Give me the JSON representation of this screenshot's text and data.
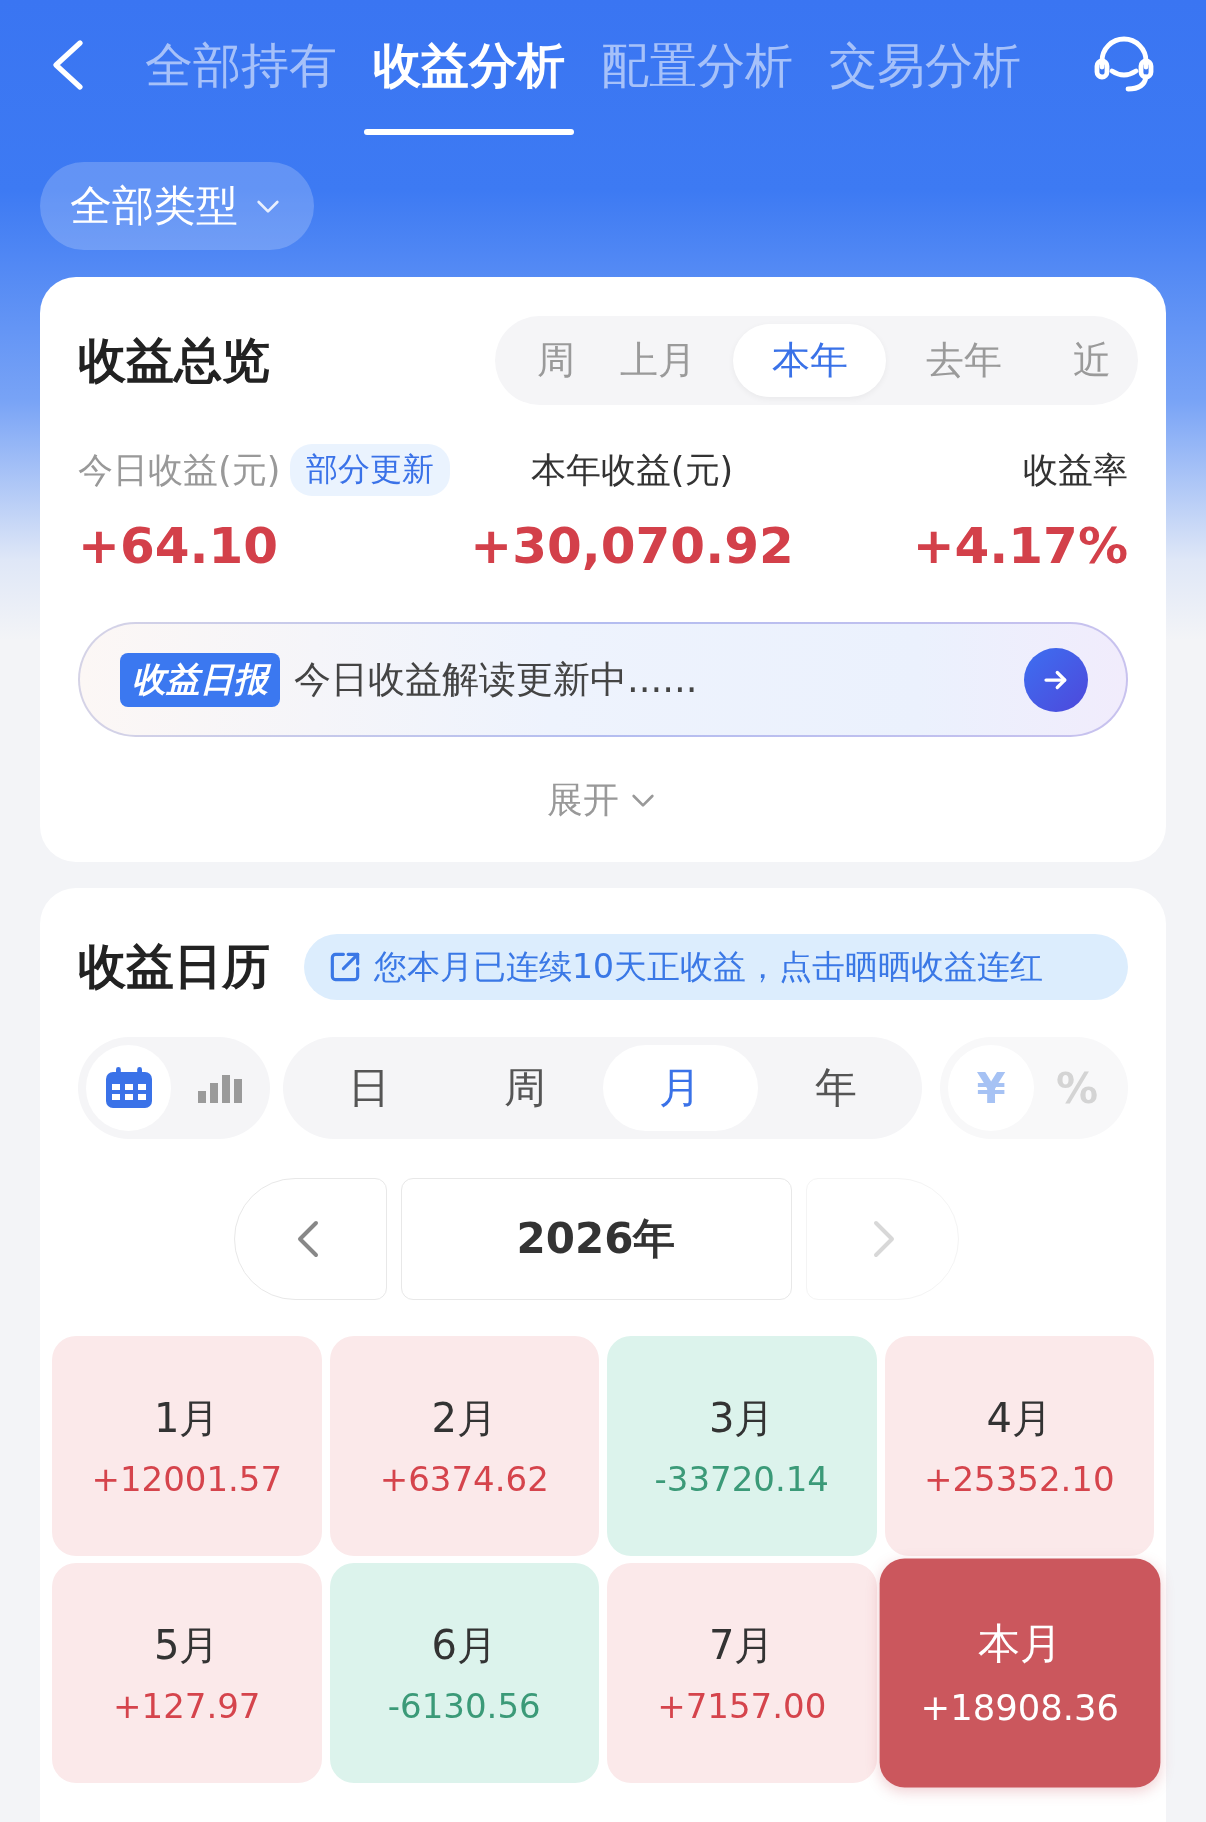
{
  "header": {
    "tabs": [
      {
        "label": "全部持有",
        "selected": false
      },
      {
        "label": "收益分析",
        "selected": true
      },
      {
        "label": "配置分析",
        "selected": false
      },
      {
        "label": "交易分析",
        "selected": false
      }
    ]
  },
  "filter": {
    "label": "全部类型"
  },
  "overview": {
    "title": "收益总览",
    "periods": [
      {
        "label": "周",
        "selected": false
      },
      {
        "label": "上月",
        "selected": false
      },
      {
        "label": "本年",
        "selected": true
      },
      {
        "label": "去年",
        "selected": false
      },
      {
        "label": "近",
        "selected": false
      }
    ],
    "metrics": [
      {
        "label": "今日收益(元)",
        "badge": "部分更新",
        "value": "+64.10",
        "dimmed": true
      },
      {
        "label": "本年收益(元)",
        "value": "+30,070.92",
        "dimmed": false
      },
      {
        "label": "收益率",
        "value": "+4.17%",
        "dimmed": false
      }
    ],
    "report": {
      "tag": "收益日报",
      "text": "今日收益解读更新中......"
    },
    "expand": "展开"
  },
  "calendar": {
    "title": "收益日历",
    "banner": "您本月已连续10天正收益，点击晒晒收益连红",
    "views": [
      {
        "kind": "calendar",
        "selected": true
      },
      {
        "kind": "chart",
        "selected": false
      }
    ],
    "periods": [
      {
        "label": "日",
        "selected": false
      },
      {
        "label": "周",
        "selected": false
      },
      {
        "label": "月",
        "selected": true
      },
      {
        "label": "年",
        "selected": false
      }
    ],
    "units": [
      {
        "label": "¥",
        "selected": true
      },
      {
        "label": "%",
        "selected": false
      }
    ],
    "nav": {
      "prev": {
        "disabled": false
      },
      "year": "2026年",
      "next": {
        "disabled": true
      }
    },
    "months": [
      {
        "label": "1月",
        "value": "+12001.57",
        "kind": "gain",
        "selected": false
      },
      {
        "label": "2月",
        "value": "+6374.62",
        "kind": "gain",
        "selected": false
      },
      {
        "label": "3月",
        "value": "-33720.14",
        "kind": "loss",
        "selected": false
      },
      {
        "label": "4月",
        "value": "+25352.10",
        "kind": "gain",
        "selected": false
      },
      {
        "label": "5月",
        "value": "+127.97",
        "kind": "gain",
        "selected": false
      },
      {
        "label": "6月",
        "value": "-6130.56",
        "kind": "loss",
        "selected": false
      },
      {
        "label": "7月",
        "value": "+7157.00",
        "kind": "gain",
        "selected": false
      },
      {
        "label": "本月",
        "value": "+18908.36",
        "kind": "gain",
        "selected": true
      }
    ]
  }
}
